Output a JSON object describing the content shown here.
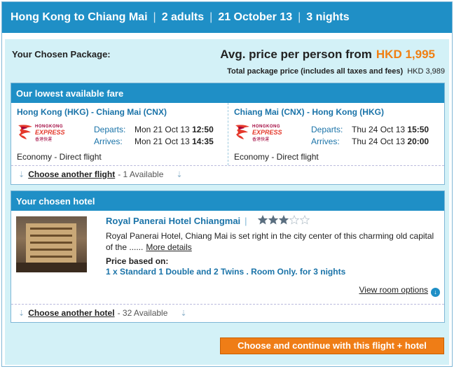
{
  "header": {
    "route": "Hong Kong to Chiang Mai",
    "travellers": "2 adults",
    "date": "21 October 13",
    "nights": "3 nights",
    "separator": "|"
  },
  "package": {
    "label": "Your Chosen Package:",
    "avg_label": "Avg. price per person from",
    "avg_price": "HKD 1,995",
    "total_label": "Total package price (includes all taxes and fees)",
    "total_price": "HKD 3,989"
  },
  "fare": {
    "title": "Our lowest available fare",
    "airline_logo": {
      "line1": "HONGKONG",
      "line2": "EXPRESS",
      "line3": "香港快運"
    },
    "flights": [
      {
        "route": "Hong Kong (HKG) - Chiang Mai (CNX)",
        "departs_label": "Departs:",
        "departs_date": "Mon 21 Oct 13",
        "departs_time": "12:50",
        "arrives_label": "Arrives:",
        "arrives_date": "Mon 21 Oct 13",
        "arrives_time": "14:35",
        "cabin": "Economy - Direct flight"
      },
      {
        "route": "Chiang Mai (CNX) - Hong Kong (HKG)",
        "departs_label": "Departs:",
        "departs_date": "Thu 24 Oct 13",
        "departs_time": "15:50",
        "arrives_label": "Arrives:",
        "arrives_date": "Thu 24 Oct 13",
        "arrives_time": "20:00",
        "cabin": "Economy - Direct flight"
      }
    ],
    "choose_label": "Choose another flight",
    "choose_avail": "- 1 Available"
  },
  "hotel": {
    "title": "Your chosen hotel",
    "name": "Royal Panerai Hotel Chiangmai",
    "rating": 3,
    "rating_max": 5,
    "description": "Royal Panerai Hotel, Chiang Mai is set right in the city center of this charming old capital of the ......",
    "more_details": "More details",
    "price_based_on": "Price based on:",
    "room": "1 x Standard 1 Double and 2 Twins . Room Only. for 3 nights",
    "view_room_options": "View room options",
    "choose_label": "Choose another hotel",
    "choose_avail": "- 32 Available"
  },
  "cta": {
    "label": "Choose and continue with this flight + hotel"
  },
  "colors": {
    "header_blue": "#1f8fc6",
    "panel_bg": "#d3f1f7",
    "link_blue": "#1a73a8",
    "price_orange": "#f07f12",
    "cta_orange": "#ef7d16",
    "star_filled": "#5b6f80"
  }
}
